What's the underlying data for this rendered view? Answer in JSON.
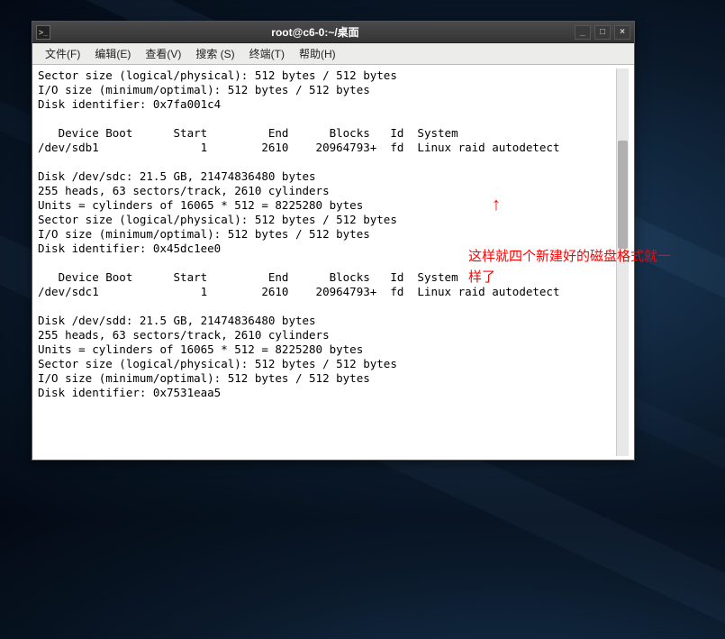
{
  "window": {
    "title": "root@c6-0:~/桌面",
    "icon_glyph": ">_"
  },
  "menu": {
    "file": "文件(F)",
    "edit": "编辑(E)",
    "view": "查看(V)",
    "search": "搜索 (S)",
    "terminal": "终端(T)",
    "help": "帮助(H)"
  },
  "terminal": {
    "lines": [
      "Sector size (logical/physical): 512 bytes / 512 bytes",
      "I/O size (minimum/optimal): 512 bytes / 512 bytes",
      "Disk identifier: 0x7fa001c4",
      "",
      "   Device Boot      Start         End      Blocks   Id  System",
      "/dev/sdb1               1        2610    20964793+  fd  Linux raid autodetect",
      "",
      "Disk /dev/sdc: 21.5 GB, 21474836480 bytes",
      "255 heads, 63 sectors/track, 2610 cylinders",
      "Units = cylinders of 16065 * 512 = 8225280 bytes",
      "Sector size (logical/physical): 512 bytes / 512 bytes",
      "I/O size (minimum/optimal): 512 bytes / 512 bytes",
      "Disk identifier: 0x45dc1ee0",
      "",
      "   Device Boot      Start         End      Blocks   Id  System",
      "/dev/sdc1               1        2610    20964793+  fd  Linux raid autodetect",
      "",
      "Disk /dev/sdd: 21.5 GB, 21474836480 bytes",
      "255 heads, 63 sectors/track, 2610 cylinders",
      "Units = cylinders of 16065 * 512 = 8225280 bytes",
      "Sector size (logical/physical): 512 bytes / 512 bytes",
      "I/O size (minimum/optimal): 512 bytes / 512 bytes",
      "Disk identifier: 0x7531eaa5"
    ]
  },
  "annotation": {
    "arrow": "↑",
    "text": "这样就四个新建好的磁盘格式就一样了"
  }
}
